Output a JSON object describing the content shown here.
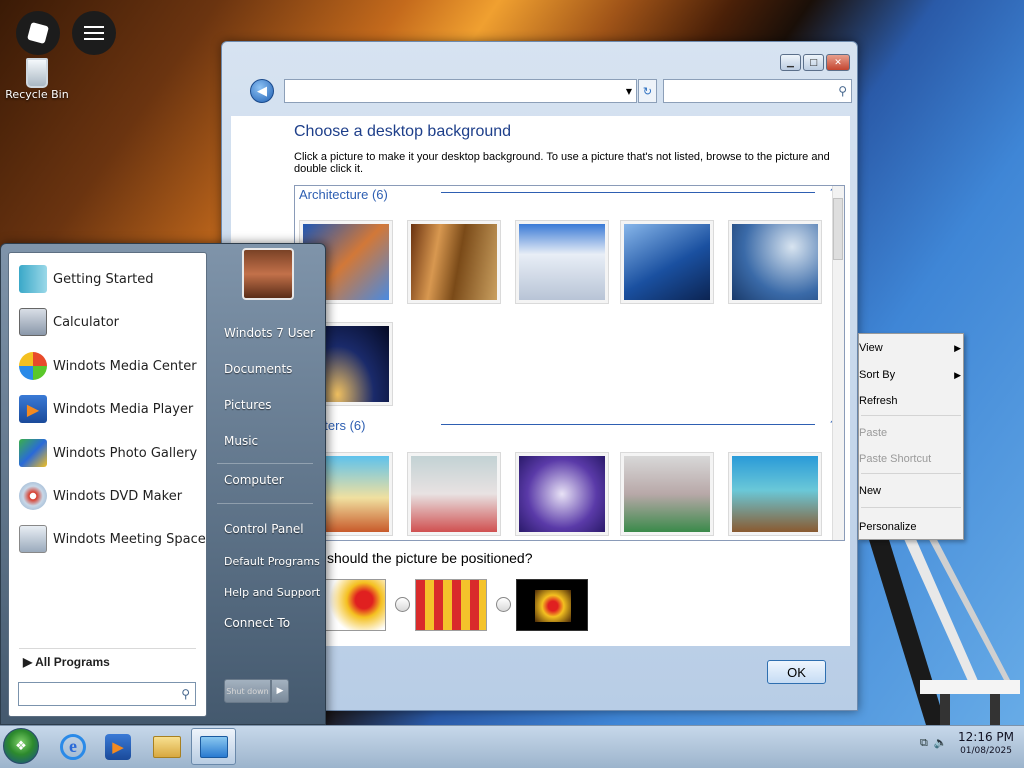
{
  "desktop": {
    "recycle_bin_label": "Recycle Bin"
  },
  "window": {
    "address_value": "",
    "search_value": "",
    "title": "Choose a desktop background",
    "description": "Click a picture to make it your desktop background. To use a picture that's not listed, browse to the picture and double click it.",
    "groups": [
      {
        "label": "Architecture (6)",
        "count": 6
      },
      {
        "label": "aracters (6)",
        "count": 6
      }
    ],
    "position_question": "should the picture be positioned?",
    "ok_label": "OK"
  },
  "context_menu": {
    "items": [
      {
        "label": "View",
        "enabled": true,
        "submenu": true
      },
      {
        "label": "Sort By",
        "enabled": true,
        "submenu": true
      },
      {
        "label": "Refresh",
        "enabled": true,
        "submenu": false
      },
      {
        "label": "Paste",
        "enabled": false,
        "submenu": false
      },
      {
        "label": "Paste Shortcut",
        "enabled": false,
        "submenu": false
      },
      {
        "label": "New",
        "enabled": true,
        "submenu": false
      },
      {
        "label": "Personalize",
        "enabled": true,
        "submenu": false
      }
    ]
  },
  "start_menu": {
    "programs": [
      {
        "label": "Getting Started",
        "icon": "getting-started-icon"
      },
      {
        "label": "Calculator",
        "icon": "calculator-icon"
      },
      {
        "label": "Windots Media Center",
        "icon": "media-center-icon"
      },
      {
        "label": "Windots Media Player",
        "icon": "media-player-icon"
      },
      {
        "label": "Windots Photo Gallery",
        "icon": "photo-gallery-icon"
      },
      {
        "label": "Windots DVD Maker",
        "icon": "dvd-maker-icon"
      },
      {
        "label": "Windots Meeting Space",
        "icon": "meeting-space-icon"
      }
    ],
    "all_programs_label": "All Programs",
    "search_value": "",
    "user_name": "Windots 7 User",
    "right_items": {
      "documents": "Documents",
      "pictures": "Pictures",
      "music": "Music",
      "computer": "Computer",
      "control_panel": "Control Panel",
      "default_programs": "Default Programs",
      "help_support": "Help and Support",
      "connect_to": "Connect To"
    },
    "shutdown_label": "Shut down"
  },
  "taskbar": {
    "time": "12:16 PM",
    "date": "01/08/2025",
    "pinned": [
      "internet-explorer-icon",
      "media-player-icon",
      "folder-icon",
      "control-panel-icon"
    ]
  }
}
